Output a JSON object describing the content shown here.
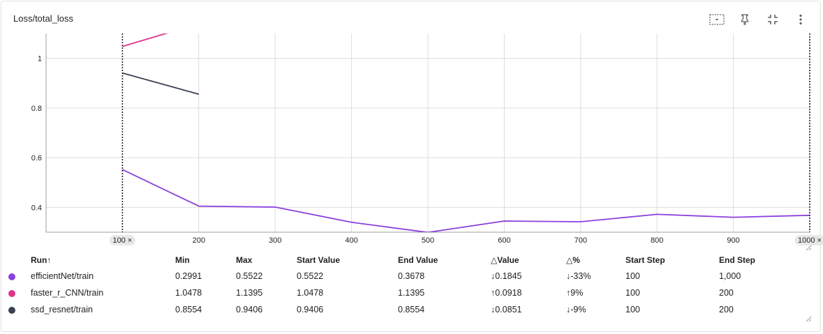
{
  "card": {
    "title": "Loss/total_loss"
  },
  "toolbar": {
    "icons": [
      "fit-to-data-icon",
      "pin-icon",
      "collapse-icon",
      "more-vert-icon"
    ]
  },
  "colors": {
    "efficientNet": "#8a3fe0",
    "faster_r_CNN": "#e0338a",
    "ssd_resnet": "#3a4052",
    "grid": "#dddddd"
  },
  "chart_data": {
    "type": "line",
    "title": "Loss/total_loss",
    "xlabel": "",
    "ylabel": "",
    "xlim": [
      0,
      1000
    ],
    "ylim": [
      0.3,
      1.1
    ],
    "x_ticks": [
      200,
      300,
      400,
      500,
      600,
      700,
      800,
      900
    ],
    "y_ticks": [
      0.4,
      0.6,
      0.8,
      1
    ],
    "grid": true,
    "step_markers": [
      {
        "label": "100 ×",
        "x": 100
      },
      {
        "label": "1000 ×",
        "x": 1000
      }
    ],
    "series": [
      {
        "name": "efficientNet/train",
        "color_key": "efficientNet",
        "x": [
          100,
          200,
          300,
          400,
          500,
          600,
          700,
          800,
          900,
          1000
        ],
        "y": [
          0.5522,
          0.405,
          0.401,
          0.34,
          0.2991,
          0.345,
          0.342,
          0.372,
          0.36,
          0.3678
        ]
      },
      {
        "name": "faster_r_CNN/train",
        "color_key": "faster_r_CNN",
        "x": [
          100,
          200
        ],
        "y": [
          1.0478,
          1.1395
        ]
      },
      {
        "name": "ssd_resnet/train",
        "color_key": "ssd_resnet",
        "x": [
          100,
          200
        ],
        "y": [
          0.9406,
          0.8554
        ]
      }
    ]
  },
  "table": {
    "headers": [
      "Run↑",
      "Min",
      "Max",
      "Start Value",
      "End Value",
      "△Value",
      "△%",
      "Start Step",
      "End Step"
    ],
    "rows": [
      {
        "color_key": "efficientNet",
        "run": "efficientNet/train",
        "min": "0.2991",
        "max": "0.5522",
        "start": "0.5522",
        "end": "0.3678",
        "dvalue": "↓0.1845",
        "dpct": "↓-33%",
        "start_step": "100",
        "end_step": "1,000"
      },
      {
        "color_key": "faster_r_CNN",
        "run": "faster_r_CNN/train",
        "min": "1.0478",
        "max": "1.1395",
        "start": "1.0478",
        "end": "1.1395",
        "dvalue": "↑0.0918",
        "dpct": "↑9%",
        "start_step": "100",
        "end_step": "200"
      },
      {
        "color_key": "ssd_resnet",
        "run": "ssd_resnet/train",
        "min": "0.8554",
        "max": "0.9406",
        "start": "0.9406",
        "end": "0.8554",
        "dvalue": "↓0.0851",
        "dpct": "↓-9%",
        "start_step": "100",
        "end_step": "200"
      }
    ]
  }
}
